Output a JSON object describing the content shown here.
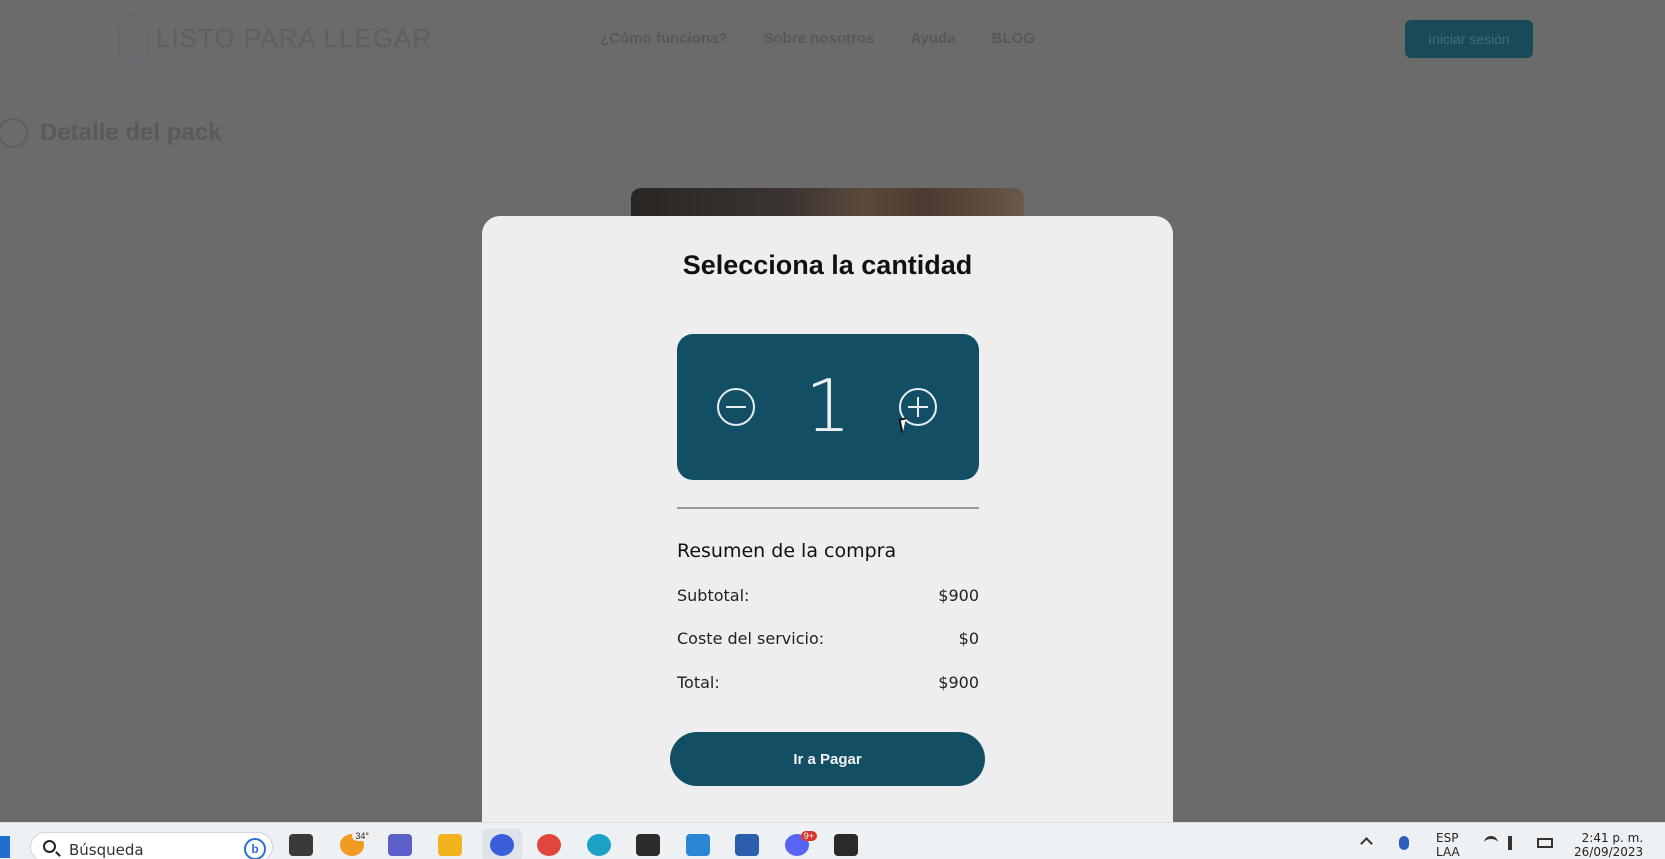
{
  "background": {
    "logo_text": "LISTO PARA LLEGAR",
    "nav": [
      "¿Cómo funciona?",
      "Sobre nosotros",
      "Ayuda",
      "BLOG",
      ""
    ],
    "login_label": "Iniciar sesión",
    "back_title": "Detalle del pack"
  },
  "modal": {
    "title": "Selecciona la cantidad",
    "quantity": "1",
    "summary_title": "Resumen de la compra",
    "rows": [
      {
        "label": "Subtotal:",
        "value": "$900"
      },
      {
        "label": "Coste del servicio:",
        "value": "$0"
      },
      {
        "label": "Total:",
        "value": "$900"
      }
    ],
    "pay_label": "Ir a Pagar"
  },
  "taskbar": {
    "search_placeholder": "Búsqueda",
    "weather_badge": "34°",
    "discord_badge": "9+",
    "lang": "ESP",
    "lang_sub": "LAA",
    "time": "2:41 p. m.",
    "date": "26/09/2023"
  },
  "colors": {
    "accent": "#134f64",
    "modal_bg": "#eeeeef",
    "overlay": "#6b6b6b"
  }
}
